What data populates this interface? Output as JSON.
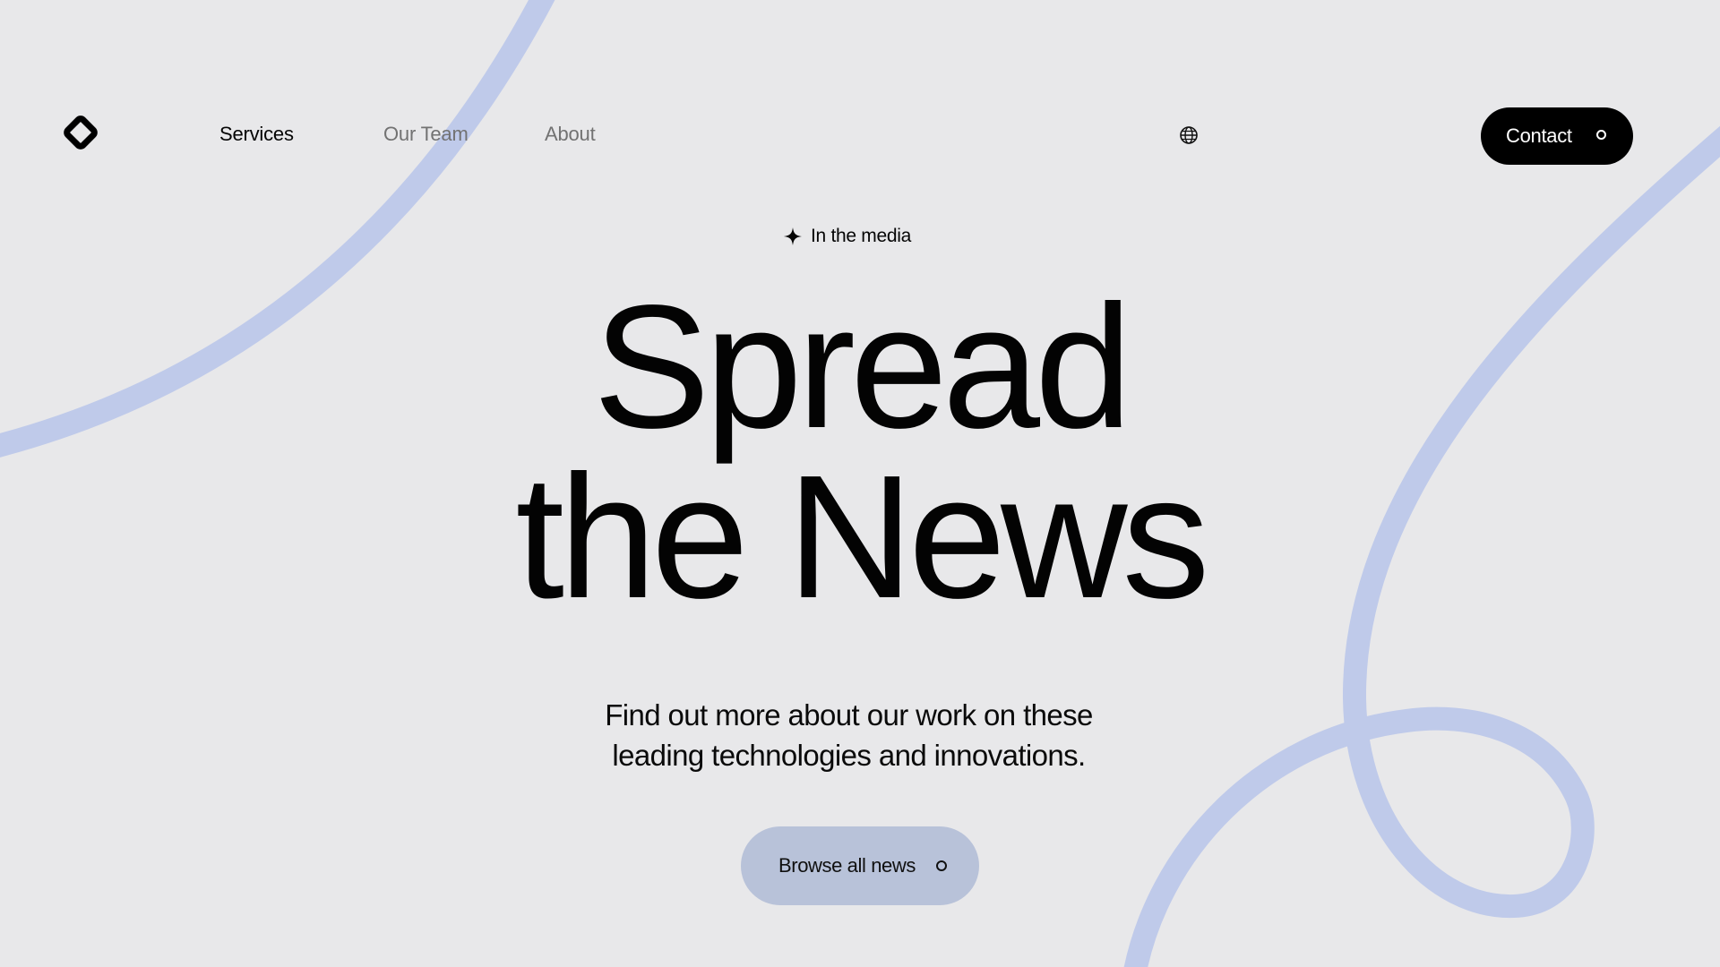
{
  "nav": {
    "logo": "diamond-logo-icon",
    "links": [
      {
        "label": "Services",
        "active": true
      },
      {
        "label": "Our Team",
        "active": false
      },
      {
        "label": "About",
        "active": false
      }
    ],
    "language_icon": "globe-icon",
    "contact": {
      "label": "Contact",
      "icon": "circle-icon"
    }
  },
  "hero": {
    "eyebrow_icon": "sparkle-icon",
    "eyebrow": "In the media",
    "headline_line1": "Spread",
    "headline_line2": "the News",
    "subtitle_line1": "Find out more about our work on these",
    "subtitle_line2": "leading technologies and innovations.",
    "cta": {
      "label": "Browse all news",
      "icon": "circle-icon"
    }
  },
  "colors": {
    "background": "#e8e8ea",
    "decor_stroke": "#bfcaea",
    "cta_background": "#b8c2d9",
    "contact_background": "#000000"
  }
}
